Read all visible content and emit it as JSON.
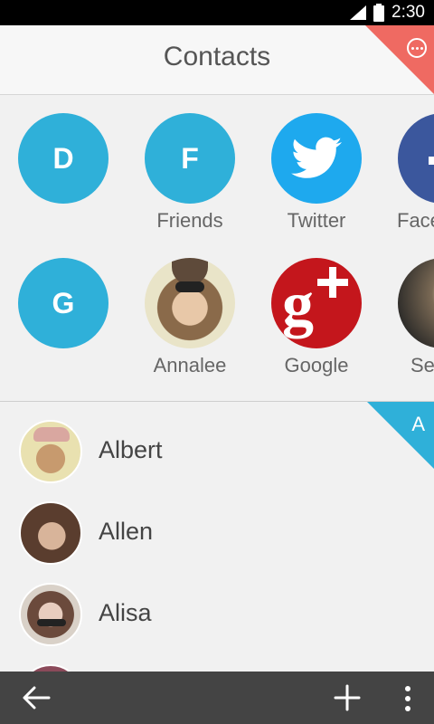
{
  "status": {
    "time": "2:30"
  },
  "header": {
    "title": "Contacts"
  },
  "groups": [
    {
      "letter": "D",
      "label": ""
    },
    {
      "letter": "F",
      "label": "Friends"
    },
    {
      "letter": "",
      "label": "Twitter",
      "icon": "twitter-icon"
    },
    {
      "letter": "",
      "label": "Face",
      "icon": "facebook-icon"
    },
    {
      "letter": "G",
      "label": ""
    },
    {
      "letter": "",
      "label": "Annalee"
    },
    {
      "letter": "",
      "label": "Google",
      "icon": "google-plus-icon"
    },
    {
      "letter": "",
      "label": "Se"
    }
  ],
  "list": {
    "section_letter": "A",
    "contacts": [
      {
        "name": "Albert"
      },
      {
        "name": "Allen"
      },
      {
        "name": "Alisa"
      }
    ]
  },
  "colors": {
    "accent": "#2fb0d9",
    "corner": "#ef6a62",
    "bar": "#444444"
  },
  "icons": [
    "back-arrow-icon",
    "add-icon",
    "overflow-menu-icon",
    "more-options-icon",
    "signal-icon",
    "battery-icon"
  ]
}
